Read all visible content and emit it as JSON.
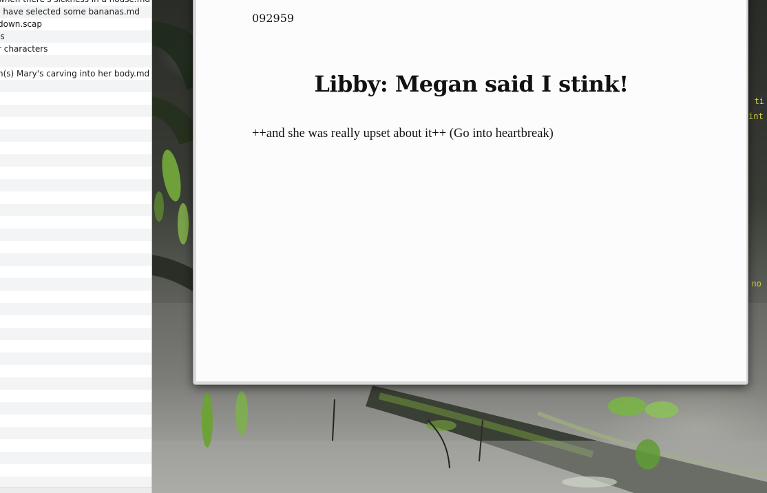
{
  "file_list": {
    "items": [
      "when there's sickness in a house.md",
      "I have selected some bananas.md",
      "down.scap",
      "ls",
      "r characters",
      "",
      "n(s) Mary's carving into her body.md",
      "",
      "",
      "",
      "",
      "",
      "",
      "",
      "",
      "",
      "",
      "",
      "",
      "",
      "",
      "",
      "",
      "",
      "",
      "",
      "",
      "",
      "",
      "",
      "",
      "",
      "",
      "",
      "",
      "",
      "",
      "",
      "",
      "",
      ""
    ]
  },
  "document": {
    "id_line": "092959",
    "heading": "Libby: Megan said I stink!",
    "body": "++and she was really upset about it++ (Go into heartbreak)"
  },
  "background_code": {
    "line1": "l ti",
    "line2": "int",
    "line3": "e no"
  },
  "colors": {
    "code_text": "#d9cf43",
    "list_stripe": "#f3f4f6",
    "page_bg": "#fcfcfc"
  }
}
